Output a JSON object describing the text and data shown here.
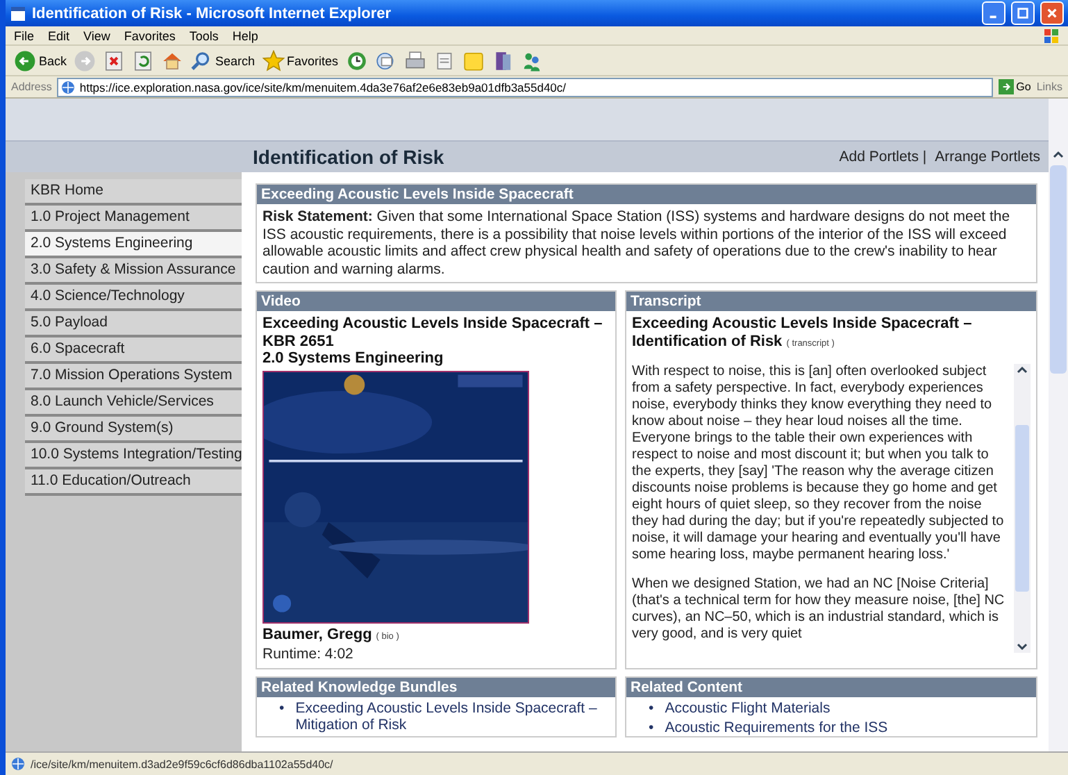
{
  "window": {
    "title": "Identification of Risk - Microsoft Internet Explorer"
  },
  "menu": [
    "File",
    "Edit",
    "View",
    "Favorites",
    "Tools",
    "Help"
  ],
  "toolbar": [
    {
      "kind": "back",
      "label": "Back"
    },
    {
      "kind": "forward"
    },
    {
      "kind": "stop"
    },
    {
      "kind": "refresh"
    },
    {
      "kind": "home"
    },
    {
      "kind": "search",
      "label": "Search"
    },
    {
      "kind": "favorites",
      "label": "Favorites"
    },
    {
      "kind": "history"
    },
    {
      "kind": "mail"
    },
    {
      "kind": "print"
    },
    {
      "kind": "edit"
    },
    {
      "kind": "note"
    },
    {
      "kind": "folder"
    },
    {
      "kind": "messenger"
    }
  ],
  "address": {
    "label": "Address",
    "url": "https://ice.exploration.nasa.gov/ice/site/km/menuitem.4da3e76af2e6e83eb9a01dfb3a55d40c/",
    "go": "Go",
    "links": "Links"
  },
  "page": {
    "title": "Identification of Risk",
    "portlet_links": [
      "Add Portlets |",
      "Arrange Portlets"
    ]
  },
  "sidebar": {
    "items": [
      {
        "label": "KBR Home",
        "selected": false
      },
      {
        "label": "1.0 Project Management",
        "selected": false
      },
      {
        "label": "2.0 Systems Engineering",
        "selected": true
      },
      {
        "label": "3.0 Safety & Mission Assurance",
        "selected": false
      },
      {
        "label": "4.0 Science/Technology",
        "selected": false
      },
      {
        "label": "5.0 Payload",
        "selected": false
      },
      {
        "label": "6.0 Spacecraft",
        "selected": false
      },
      {
        "label": "7.0 Mission Operations System",
        "selected": false
      },
      {
        "label": "8.0 Launch Vehicle/Services",
        "selected": false
      },
      {
        "label": "9.0 Ground System(s)",
        "selected": false
      },
      {
        "label": "10.0 Systems Integration/Testing",
        "selected": false
      },
      {
        "label": "11.0 Education/Outreach",
        "selected": false
      }
    ]
  },
  "risk": {
    "header": "Exceeding Acoustic Levels Inside Spacecraft",
    "statement": "**Risk Statement:** Given that some International Space Station (ISS) systems and hardware designs do not meet the ISS acoustic requirements, there is a possibility that noise levels within portions of the interior of the ISS will exceed allowable acoustic limits and affect crew physical health and safety of operations due to the crew's inability to hear caution and warning alarms."
  },
  "video": {
    "header": "Video",
    "title": "Exceeding Acoustic Levels Inside Spacecraft – KBR 2651",
    "subtitle": "2.0 Systems Engineering",
    "presenter": "Baumer, Gregg",
    "bio_link": "( bio )",
    "runtime": "Runtime: 4:02"
  },
  "transcript": {
    "header": "Transcript",
    "title": "Exceeding Acoustic Levels Inside Spacecraft – Identification of Risk",
    "link": "( transcript )",
    "paragraphs": [
      "With respect to noise, this is [an] often overlooked subject from a safety perspective. In fact, everybody experiences noise, everybody thinks they know everything they need to know about noise – they hear loud noises all the time. Everyone brings to the table their own experiences with respect to noise and most discount it; but when you talk to the experts, they [say] 'The reason why the average citizen discounts noise problems is because they go home and get eight hours of quiet sleep, so they recover from the noise they had during the day; but if you're repeatedly subjected to noise, it will damage your hearing and eventually you'll have some hearing loss, maybe permanent hearing loss.'",
      "When we designed Station, we had an NC [Noise Criteria] (that's a technical term for how they measure noise, [the] NC curves), an NC–50, which is an industrial standard, which is very good, and is very quiet"
    ]
  },
  "related_bundles": {
    "header": "Related Knowledge Bundles",
    "marker": "•",
    "items": [
      "Exceeding Acoustic Levels Inside Spacecraft – Mitigation of Risk"
    ]
  },
  "related_content": {
    "header": "Related Content",
    "marker": "•",
    "items": [
      "Accoustic Flight Materials",
      "Acoustic Requirements for the ISS"
    ]
  },
  "status_bar": {
    "text": "/ice/site/km/menuitem.d3ad2e9f59c6cf6d86dba1102a55d40c/"
  }
}
